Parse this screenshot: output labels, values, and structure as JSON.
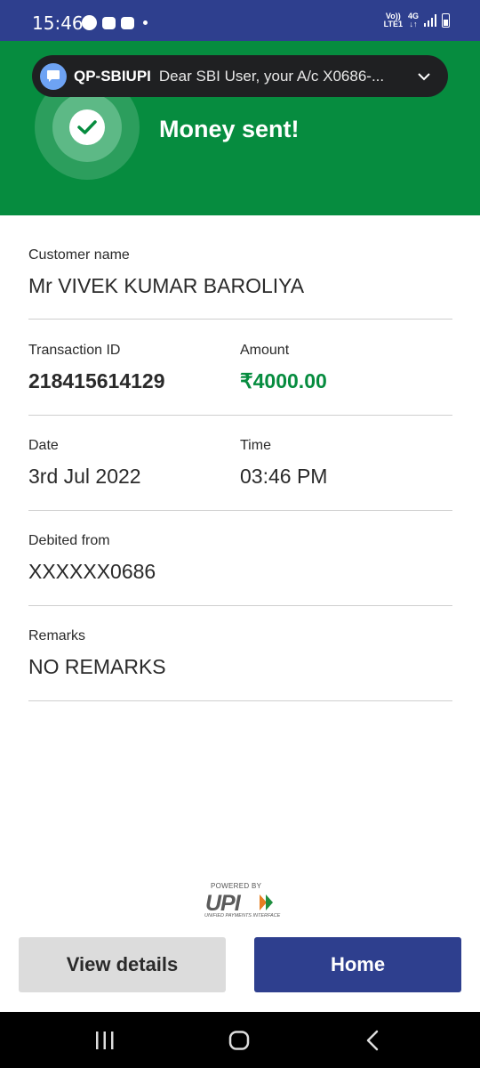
{
  "status_bar": {
    "time": "15:46",
    "network_top": "Vo))",
    "network_bottom": "LTE1",
    "network_type": "4G",
    "network_arrows": "↓↑"
  },
  "notification": {
    "sender": "QP-SBIUPI",
    "message": "Dear SBI User, your A/c X0686-..."
  },
  "hero": {
    "title": "Money sent!"
  },
  "details": {
    "customer_name_label": "Customer name",
    "customer_name": "Mr VIVEK KUMAR BAROLIYA",
    "transaction_id_label": "Transaction ID",
    "transaction_id": "218415614129",
    "amount_label": "Amount",
    "amount": "₹4000.00",
    "date_label": "Date",
    "date": "3rd Jul 2022",
    "time_label": "Time",
    "time": "03:46 PM",
    "debited_from_label": "Debited from",
    "debited_from": "XXXXXX0686",
    "remarks_label": "Remarks",
    "remarks": "NO REMARKS"
  },
  "upi": {
    "powered_by": "POWERED BY",
    "mark": "UPI",
    "subtitle": "UNIFIED PAYMENTS INTERFACE"
  },
  "buttons": {
    "view_details": "View details",
    "home": "Home"
  },
  "colors": {
    "primary": "#2e3f8e",
    "success": "#068c3f"
  }
}
